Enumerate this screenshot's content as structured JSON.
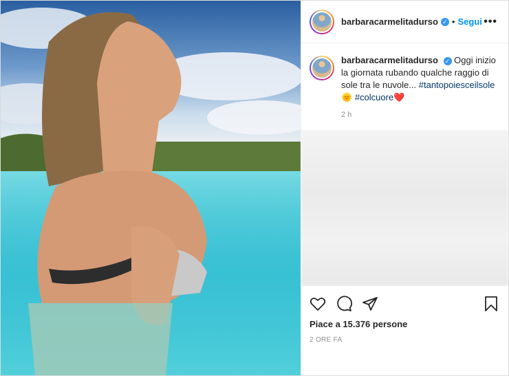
{
  "header": {
    "username": "barbaracarmelitadurso",
    "follow_label": "Segui",
    "separator": "•",
    "more_label": "•••"
  },
  "caption": {
    "username": "barbaracarmelitadurso",
    "text": "Oggi inizio la giornata rubando qualche raggio di sole tra le nuvole...",
    "hashtag1": "#tantopoiesceilsole",
    "sun_emoji": "🌞",
    "hashtag2": "#colcuore",
    "heart_emoji": "❤️",
    "time": "2 h"
  },
  "footer": {
    "likes": "Piace a 15.376 persone",
    "time_ago": "2 ORE FA"
  },
  "icons": [
    "heart-icon",
    "comment-icon",
    "share-icon",
    "bookmark-icon"
  ],
  "colors": {
    "accent": "#0095f6",
    "verified": "#3897f0",
    "hashtag": "#00376b"
  }
}
